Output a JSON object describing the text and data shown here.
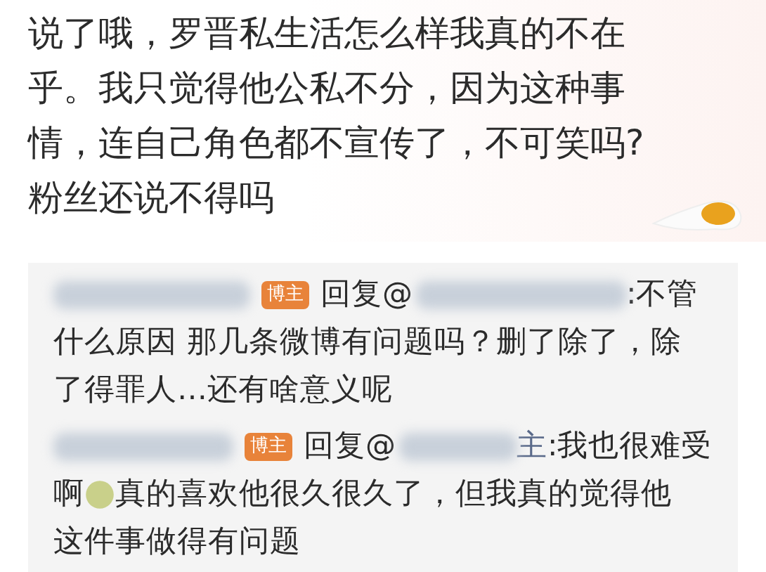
{
  "post": {
    "text": "说了哦，罗晋私生活怎么样我真的不在乎。我只觉得他公私不分，因为这种事情，连自己角色都不宣传了，不可笑吗?粉丝还说不得吗"
  },
  "replies": [
    {
      "badge": "博主",
      "reply_label": "回复@",
      "first_text": ":不管",
      "lines": [
        [
          {
            "kind": "text",
            "text": "什么原因 那几条微博有问题吗？删了除了，除"
          }
        ],
        [
          {
            "kind": "text",
            "text": "了得罪人…还有啥意义呢"
          }
        ]
      ]
    },
    {
      "badge": "博主",
      "reply_label": "回复@",
      "handle_tail": "主",
      "first_text": ":我也很难受",
      "lines": [
        [
          {
            "kind": "text",
            "text": "啊"
          },
          {
            "kind": "emoji"
          },
          {
            "kind": "text",
            "text": "真的喜欢他很久很久了，但我真的觉得他"
          }
        ],
        [
          {
            "kind": "text",
            "text": "这件事做得有问题"
          }
        ]
      ]
    }
  ]
}
